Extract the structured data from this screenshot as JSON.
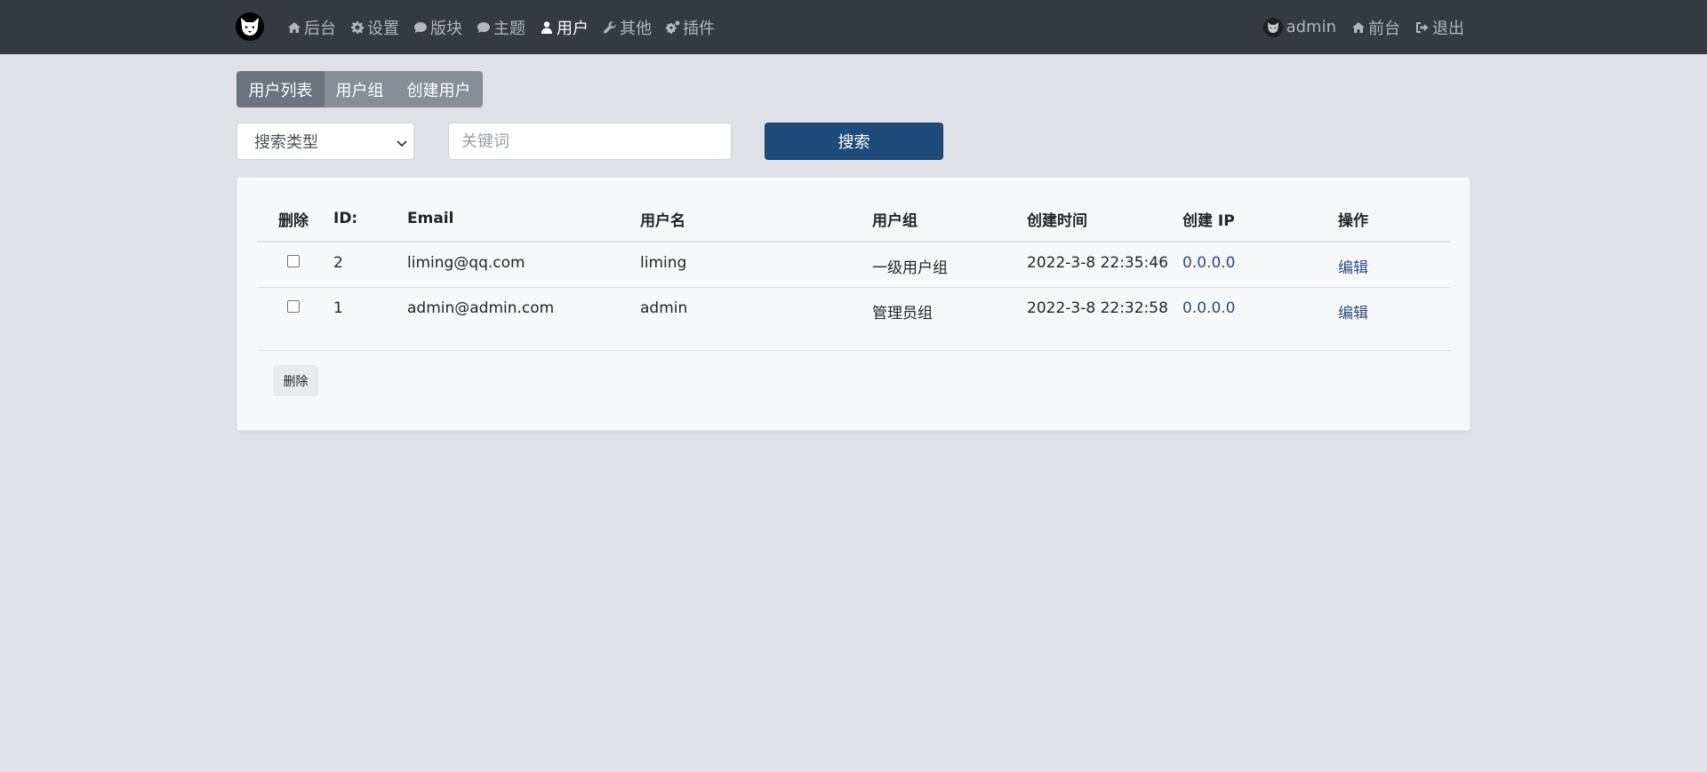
{
  "navbar": {
    "logo_icon": "cat-logo-icon",
    "left_items": [
      {
        "label": "后台",
        "icon": "home-icon"
      },
      {
        "label": "设置",
        "icon": "gear-icon"
      },
      {
        "label": "版块",
        "icon": "comment-icon"
      },
      {
        "label": "主题",
        "icon": "comment-icon"
      },
      {
        "label": "用户",
        "icon": "user-icon",
        "active": true
      },
      {
        "label": "其他",
        "icon": "wrench-icon"
      },
      {
        "label": "插件",
        "icon": "cogs-icon"
      }
    ],
    "right_items": [
      {
        "label": "admin",
        "icon": "avatar-icon"
      },
      {
        "label": "前台",
        "icon": "home-icon"
      },
      {
        "label": "退出",
        "icon": "sign-out-icon"
      }
    ]
  },
  "tabs": [
    {
      "label": "用户列表",
      "active": true
    },
    {
      "label": "用户组"
    },
    {
      "label": "创建用户"
    }
  ],
  "search": {
    "type_select": "搜索类型",
    "keyword_placeholder": "关键词",
    "button_label": "搜索"
  },
  "table": {
    "headers": {
      "delete": "删除",
      "id": "ID:",
      "email": "Email",
      "username": "用户名",
      "group": "用户组",
      "created_time": "创建时间",
      "created_ip": "创建 IP",
      "action": "操作"
    },
    "rows": [
      {
        "id": "2",
        "email": "liming@qq.com",
        "username": "liming",
        "group": "一级用户组",
        "created_time": "2022-3-8 22:35:46",
        "created_ip": "0.0.0.0",
        "action": "编辑"
      },
      {
        "id": "1",
        "email": "admin@admin.com",
        "username": "admin",
        "group": "管理员组",
        "created_time": "2022-3-8 22:32:58",
        "created_ip": "0.0.0.0",
        "action": "编辑"
      }
    ]
  },
  "bulk_delete_label": "删除",
  "colors": {
    "navbar_bg": "#343a40",
    "page_bg": "#dee1e6",
    "primary_button": "#1f4b7a",
    "link": "#2c4f7c",
    "tab_active": "#6c757d",
    "tab_inactive": "#868e96"
  }
}
